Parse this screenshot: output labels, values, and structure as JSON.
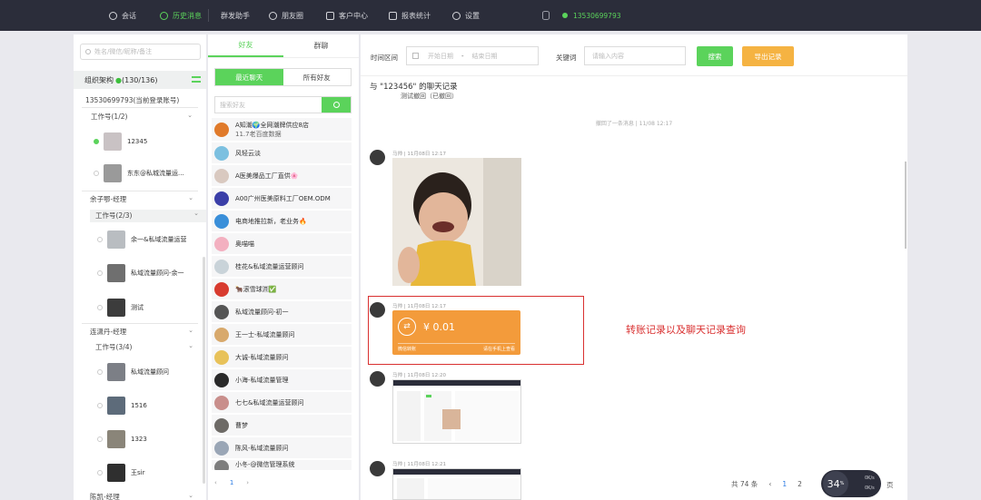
{
  "nav": {
    "items": [
      {
        "label": "会话"
      },
      {
        "label": "历史消息"
      },
      {
        "label": "群发助手"
      },
      {
        "label": "朋友圈"
      },
      {
        "label": "客户中心"
      },
      {
        "label": "报表统计"
      },
      {
        "label": "设置"
      }
    ],
    "account": "13530699793"
  },
  "left": {
    "search_placeholder": "姓名/微信/昵称/备注",
    "org_title": "组织架构",
    "org_count": "(130/136)",
    "account_row": "13530699793(当前登录账号)",
    "groups": [
      {
        "label": "工作号(1/2)"
      },
      {
        "label": "余子鄂-经理"
      },
      {
        "label": "工作号(2/3)"
      },
      {
        "label": "连潇丹-经理"
      },
      {
        "label": "工作号(3/4)"
      },
      {
        "label": "陈凯-经理"
      }
    ],
    "contacts": [
      {
        "name": "12345"
      },
      {
        "name": "东东@私城流量运..."
      },
      {
        "name": "余一&私域流量运营"
      },
      {
        "name": "私域流量顾问-余一"
      },
      {
        "name": "测试"
      },
      {
        "name": "私域流量顾问"
      },
      {
        "name": "1516"
      },
      {
        "name": "1323"
      },
      {
        "name": "王sir"
      }
    ]
  },
  "middle": {
    "tabs": [
      "好友",
      "群聊"
    ],
    "subtabs": [
      "最近聊天",
      "所有好友"
    ],
    "search_placeholder": "搜索好友",
    "friends": [
      {
        "line1": "A知潮🌍全网潮牌供应8店",
        "line2": "11.7老百度数据"
      },
      {
        "line1": "风轻云淡"
      },
      {
        "line1": "A医美爆品工厂直供🌸"
      },
      {
        "line1": "A00广州医美原料工厂OEM.ODM"
      },
      {
        "line1": "电商地推拉新，老业务🔥"
      },
      {
        "line1": "奥喵喵"
      },
      {
        "line1": "桂花&私域流量运营顾问"
      },
      {
        "line1": "🐂滚雪球🈷✅"
      },
      {
        "line1": "私域流量顾问-初一"
      },
      {
        "line1": "王一士-私域流量顾问"
      },
      {
        "line1": "大诚-私域流量顾问"
      },
      {
        "line1": "小海-私域流量管理"
      },
      {
        "line1": "七七&私域流量运营顾问"
      },
      {
        "line1": "曹梦"
      },
      {
        "line1": "陈风-私域流量顾问"
      },
      {
        "line1": "小冬-@微信管理系统"
      }
    ],
    "pager": {
      "prev": "‹",
      "current": "1",
      "next": "›"
    }
  },
  "right": {
    "filter": {
      "time_label": "时间区间",
      "start_placeholder": "开始日期",
      "dash": "-",
      "end_placeholder": "结束日期",
      "keyword_label": "关键词",
      "keyword_placeholder": "请输入内容",
      "search_button": "搜索",
      "export_button": "导出记录"
    },
    "chat_title": "与 \"123456\" 的聊天记录",
    "chat_subtitle": "测试撤回（已撤回）",
    "recall_note": "撤回了一条消息 | 11/08 12:17",
    "messages": [
      {
        "meta": "马帅 | 11月08日 12:17"
      },
      {
        "meta": "马帅 | 11月08日 12:17"
      },
      {
        "meta": "马帅 | 11月08日 12:20"
      },
      {
        "meta": "马帅 | 11月08日 12:21"
      }
    ],
    "transfer": {
      "amount": "¥ 0.01",
      "left": "微信转账",
      "right": "请在手机上查看"
    },
    "annotation": "转账记录以及聊天记录查询",
    "pager": {
      "total": "共 74 条",
      "prev": "‹",
      "page1": "1",
      "page2": "2",
      "tail": "页"
    }
  },
  "netmonitor": {
    "percent": "34",
    "unit": "%",
    "up": "0K/s",
    "down": "0K/s"
  },
  "colors": {
    "accent": "#5bd35b",
    "nav_bg": "#2b2d3a",
    "export": "#f5b342",
    "transfer": "#f39b3b",
    "highlight": "#d93030",
    "link": "#2b7be3"
  }
}
